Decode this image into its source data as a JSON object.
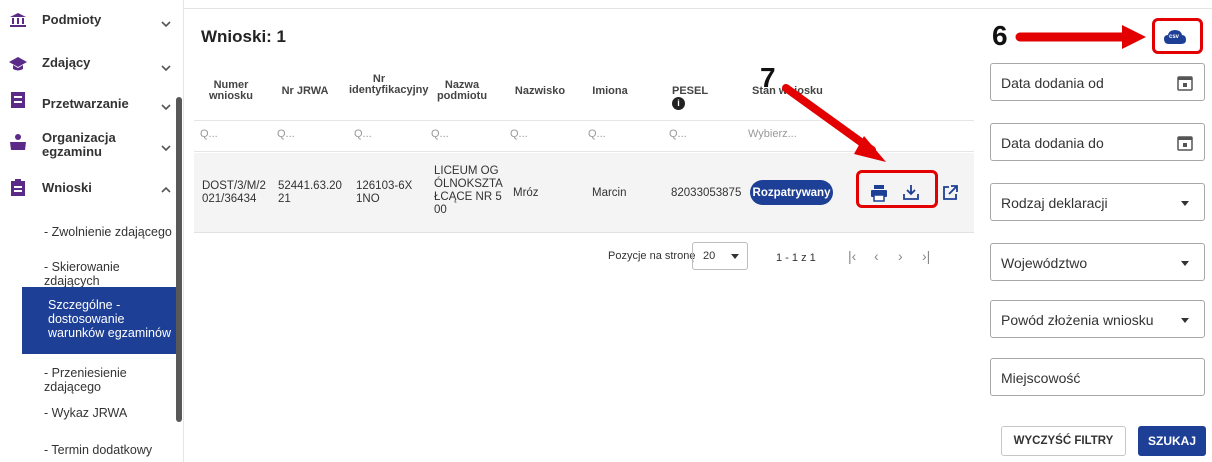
{
  "sidebar": {
    "items": [
      {
        "label": "Podmioty",
        "icon": "institution-icon",
        "expanded": false
      },
      {
        "label": "Zdający",
        "icon": "graduation-cap-icon",
        "expanded": false
      },
      {
        "label": "Przetwarzanie",
        "icon": "folder-icon",
        "expanded": false
      },
      {
        "label": "Organizacja egzaminu",
        "icon": "person-desk-icon",
        "expanded": false
      },
      {
        "label": "Wnioski",
        "icon": "clipboard-icon",
        "expanded": true
      }
    ],
    "subitems": [
      "- Zwolnienie zdającego",
      "- Skierowanie zdających",
      "Szczególne - dostosowanie warunków egzaminów",
      "- Przeniesienie zdającego",
      "- Wykaz JRWA",
      "- Termin dodatkowy"
    ]
  },
  "main": {
    "title": "Wnioski: 1",
    "columns": [
      "Numer wniosku",
      "Nr JRWA",
      "Nr identyfikacyjny",
      "Nazwa podmiotu",
      "Nazwisko",
      "Imiona",
      "PESEL",
      "Stan wniosku"
    ],
    "filter_placeholder": "Q...",
    "status_filter_placeholder": "Wybierz...",
    "rows": [
      {
        "numer": "DOST/3/M/2021/36434",
        "jrwa": "52441.63.2021",
        "identyfikacyjny": "126103-6X1NO",
        "podmiot": "LICEUM OGÓLNOKSZTAŁCĄCE NR 500",
        "nazwisko": "Mróz",
        "imiona": "Marcin",
        "pesel": "82033053875",
        "stan": "Rozpatrywany"
      }
    ],
    "pagination": {
      "per_page_label": "Pozycje na stronę",
      "per_page_value": "20",
      "range": "1 - 1 z 1"
    }
  },
  "filters": {
    "date_from": "Data dodania od",
    "date_to": "Data dodania do",
    "declaration_type": "Rodzaj deklaracji",
    "voivodeship": "Województwo",
    "reason": "Powód złożenia wniosku",
    "city": "Miejscowość",
    "clear_label": "WYCZYŚĆ FILTRY",
    "search_label": "SZUKAJ",
    "csv_label": "csv"
  },
  "annotations": {
    "six": "6",
    "seven": "7"
  },
  "colors": {
    "primary": "#1e3f96",
    "annotation": "#e20000"
  }
}
